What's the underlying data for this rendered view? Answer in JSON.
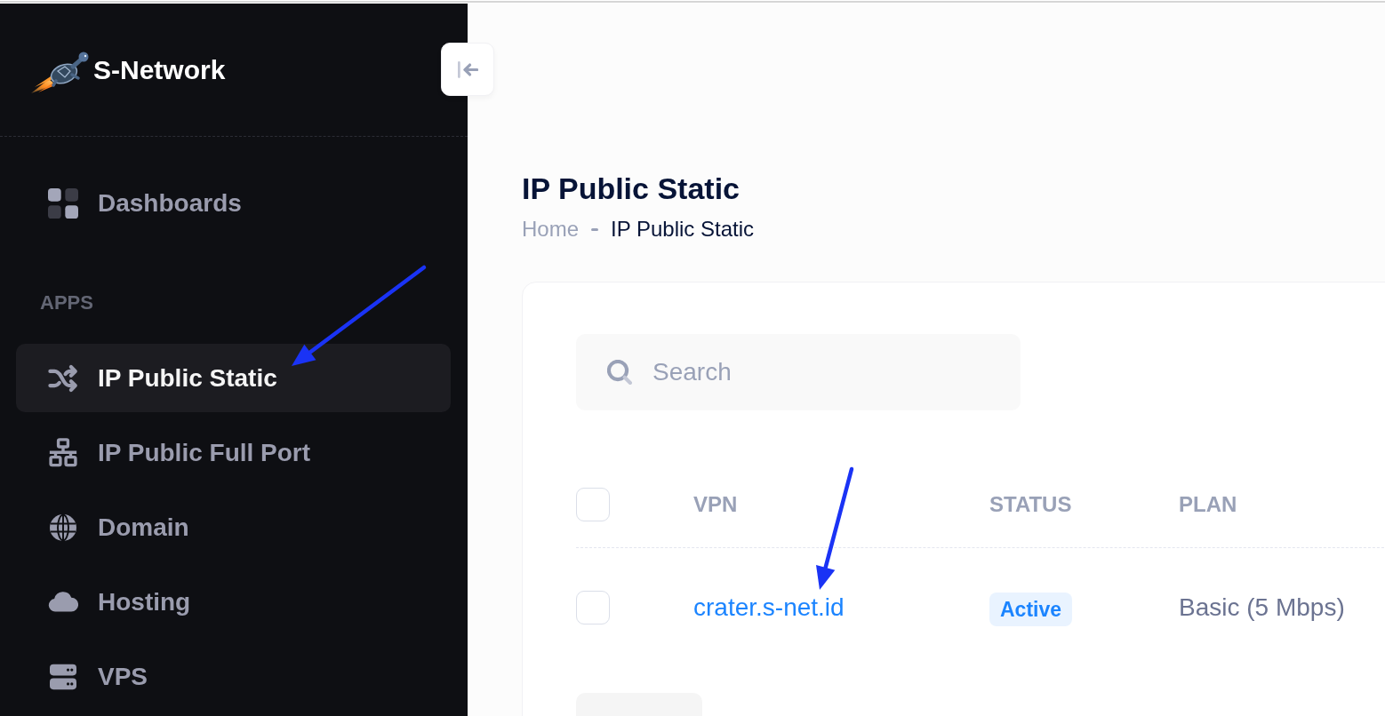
{
  "brand": {
    "name": "S-Network"
  },
  "sidebar": {
    "top_items": [
      {
        "label": "Dashboards",
        "selected": false,
        "annotated_with_arrow": false
      }
    ],
    "sections": [
      {
        "heading": "APPS",
        "items": [
          {
            "label": "IP Public Static",
            "selected": true,
            "annotated_with_arrow": true
          },
          {
            "label": "IP Public Full Port",
            "selected": false,
            "annotated_with_arrow": false
          },
          {
            "label": "Domain",
            "selected": false,
            "annotated_with_arrow": false
          },
          {
            "label": "Hosting",
            "selected": false,
            "annotated_with_arrow": false
          },
          {
            "label": "VPS",
            "selected": false,
            "annotated_with_arrow": false
          }
        ]
      }
    ]
  },
  "page": {
    "title": "IP Public Static",
    "breadcrumb": [
      {
        "label": "Home",
        "current": false
      },
      {
        "label": "IP Public Static",
        "current": true
      }
    ]
  },
  "search": {
    "placeholder": "Search"
  },
  "table": {
    "select_all_checked": false,
    "columns": [
      "VPN",
      "STATUS",
      "PLAN"
    ],
    "rows": [
      {
        "checked": false,
        "vpn": "crater.s-net.id",
        "status": "Active",
        "plan": "Basic (5 Mbps)",
        "annotated_with_arrow": true
      }
    ]
  }
}
